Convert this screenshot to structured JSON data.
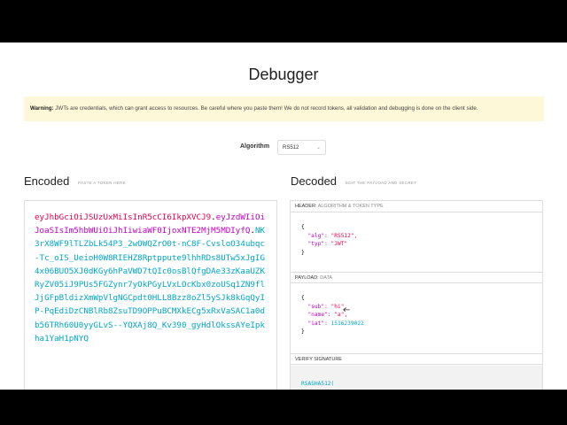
{
  "page": {
    "title": "Debugger",
    "warning_label": "Warning:",
    "warning_text": " JWTs are credentials, which can grant access to resources. Be careful where you paste them! We do not record tokens, all validation and debugging is done on the client side."
  },
  "algorithm": {
    "label": "Algorithm",
    "selected": "RS512"
  },
  "encoded": {
    "title": "Encoded",
    "subtitle": "PASTE A TOKEN HERE",
    "header_part": "eyJhbGciOiJSUzUxMiIsInR5cCI6IkpXVCJ9",
    "dot1": ".",
    "payload_part": "eyJzdWIiOiJoaSIsIm5hbWUiOiJhIiwiaWF0IjoxNTE2MjM5MDIyfQ",
    "dot2": ".",
    "signature_part": "NK3rX8WF9lTLZbLk54P3_2wOWQZrO0t-nC8F-CvsloO34ubqc-Tc_oIS_UeioH0W8RIEHZ8Rptppute9lhhRDs8UTw5xJgIG4x06BUO5XJ0dKGy6hPaVWD7tQIc0osBlQfgDAe33zKaaUZKRyZV05iJ9PUs5FGZynr7yOkPGyLVxLOcKbx0zoUSq1ZN9flJjGFpBldizXmWpVlgNGCpdt0HLL8Bzz8oZl5ySJk8kGqQyIP-PqEdiDzCNBlRb8ZsuTD9OPPuBCMXkECg5xRxVaSAC1a0db56TRh60U0yyGLvS--YQXAj8Q_Kv390_gyHdlOkssAYeIpkha1YaH1pNYQ"
  },
  "decoded": {
    "title": "Decoded",
    "subtitle": "EDIT THE PAYLOAD AND SECRET",
    "header_section": {
      "label": "HEADER:",
      "sub": "ALGORITHM & TOKEN TYPE"
    },
    "header_json": {
      "open": "{",
      "alg_key": "\"alg\": ",
      "alg_val": "\"RS512\",",
      "typ_key": "\"typ\": ",
      "typ_val": "\"JWT\"",
      "close": "}"
    },
    "payload_section": {
      "label": "PAYLOAD:",
      "sub": "DATA"
    },
    "payload_json": {
      "open": "{",
      "sub_key": "\"sub\": ",
      "sub_val": "\"hi\",",
      "name_key": "\"name\": ",
      "name_val": "\"a\",",
      "iat_key": "\"iat\": ",
      "iat_val": "1516239022",
      "close": "}"
    },
    "signature_section": {
      "label": "VERIFY SIGNATURE"
    },
    "signature_fn": "RSASHA512("
  }
}
